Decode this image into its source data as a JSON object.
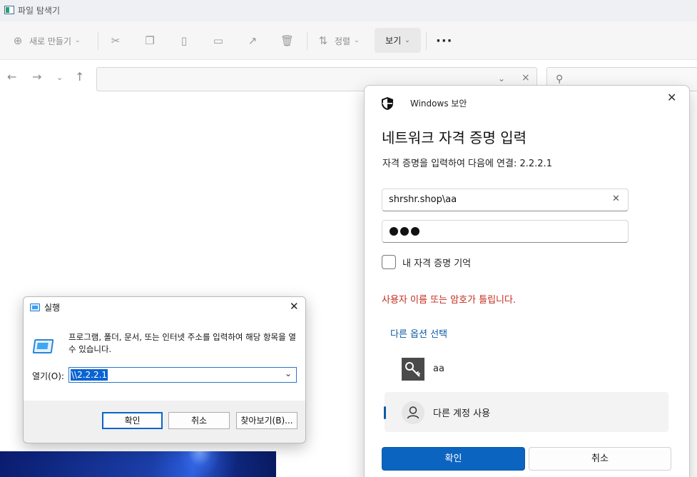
{
  "explorer": {
    "title": "파일 탐색기",
    "toolbar": {
      "new_label": "새로 만들기",
      "sort_label": "정렬",
      "view_label": "보기",
      "more_label": "···"
    }
  },
  "run_dialog": {
    "title": "실행",
    "message": "프로그램, 폴더, 문서, 또는 인터넷 주소를 입력하여 해당 항목을 열 수 있습니다.",
    "open_label": "열기(O):",
    "input_value": "\\\\2.2.2.1",
    "ok_label": "확인",
    "cancel_label": "취소",
    "browse_label": "찾아보기(B)..."
  },
  "security_dialog": {
    "app_name": "Windows 보안",
    "title": "네트워크 자격 증명 입력",
    "subtitle": "자격 증명을 입력하여 다음에 연결: 2.2.2.1",
    "username_value": "shrshr.shop\\aa",
    "password_mask_count": 3,
    "remember_label": "내 자격 증명 기억",
    "remember_checked": false,
    "error_text": "사용자 이름 또는 암호가 틀립니다.",
    "more_options": "다른 옵션 선택",
    "accounts": [
      {
        "name": "aa",
        "icon": "key-icon"
      },
      {
        "name": "다른 계정 사용",
        "icon": "person-icon"
      }
    ],
    "ok_label": "확인",
    "cancel_label": "취소",
    "colors": {
      "accent": "#0b64c0",
      "error": "#c42b1c",
      "link": "#0b5aa6"
    }
  }
}
